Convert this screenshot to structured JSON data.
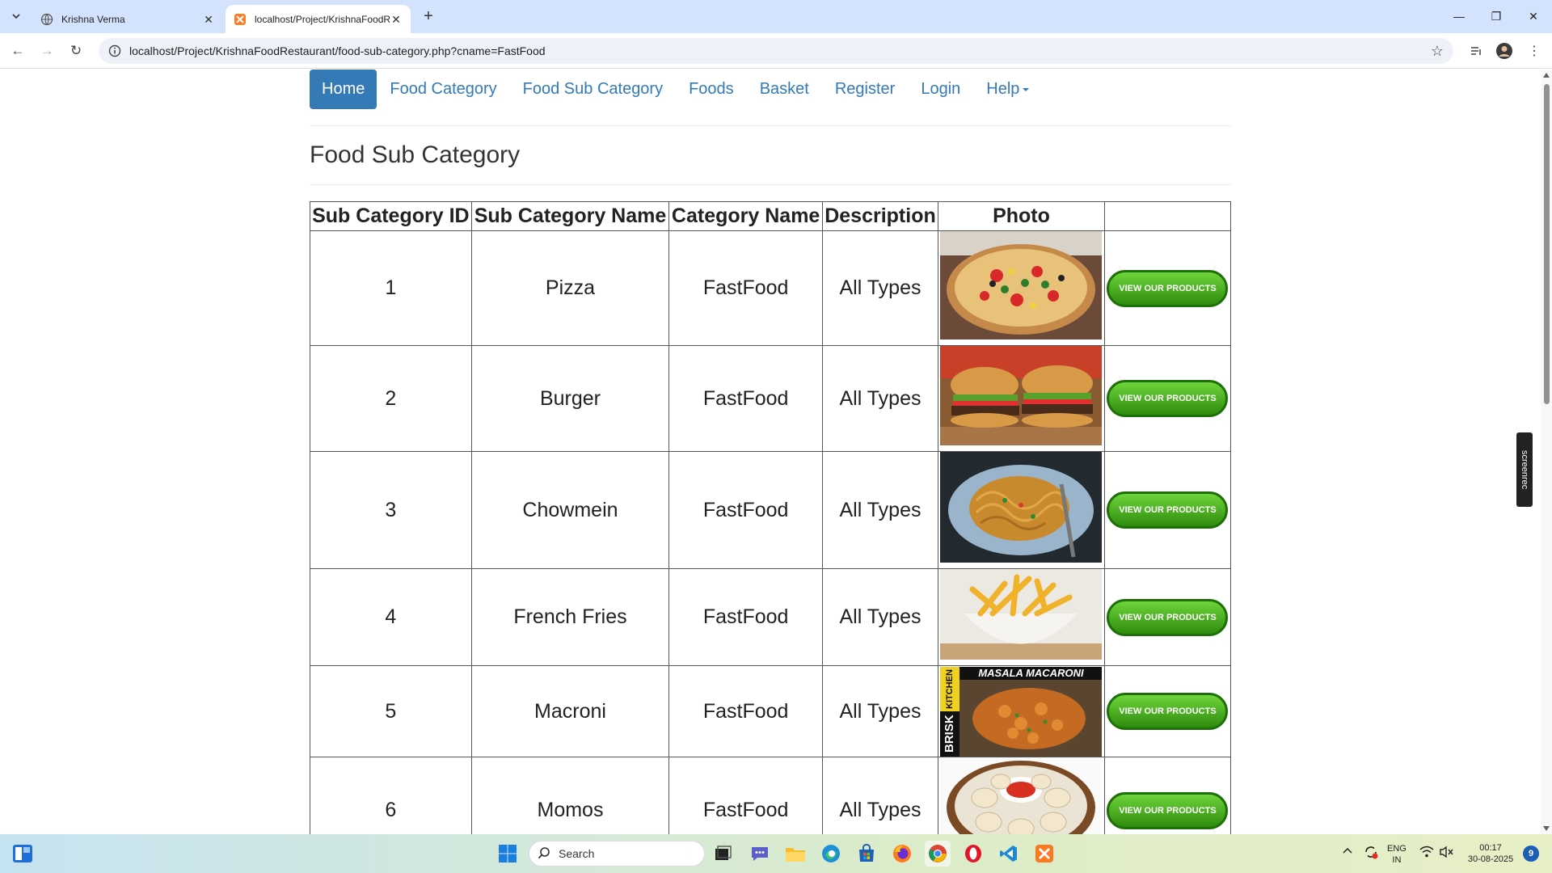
{
  "browser": {
    "tabs": [
      {
        "title": "Krishna Verma",
        "active": false
      },
      {
        "title": "localhost/Project/KrishnaFoodR",
        "active": true
      }
    ],
    "url": "localhost/Project/KrishnaFoodRestaurant/food-sub-category.php?cname=FastFood"
  },
  "nav": {
    "items": [
      {
        "label": "Home",
        "active": true
      },
      {
        "label": "Food Category"
      },
      {
        "label": "Food Sub Category"
      },
      {
        "label": "Foods"
      },
      {
        "label": "Basket"
      },
      {
        "label": "Register"
      },
      {
        "label": "Login"
      },
      {
        "label": "Help"
      }
    ]
  },
  "page": {
    "title": "Food Sub Category"
  },
  "table": {
    "headers": [
      "Sub Category ID",
      "Sub Category Name",
      "Category Name",
      "Description",
      "Photo",
      ""
    ],
    "button_label": "VIEW OUR PRODUCTS",
    "rows": [
      {
        "id": "1",
        "name": "Pizza",
        "category": "FastFood",
        "description": "All Types",
        "photo": "pizza"
      },
      {
        "id": "2",
        "name": "Burger",
        "category": "FastFood",
        "description": "All Types",
        "photo": "burger"
      },
      {
        "id": "3",
        "name": "Chowmein",
        "category": "FastFood",
        "description": "All Types",
        "photo": "chowmein"
      },
      {
        "id": "4",
        "name": "French Fries",
        "category": "FastFood",
        "description": "All Types",
        "photo": "fries"
      },
      {
        "id": "5",
        "name": "Macroni",
        "category": "FastFood",
        "description": "All Types",
        "photo": "macaroni",
        "photo_text_top": "MASALA MACARONI",
        "photo_text_side_1": "BRISK",
        "photo_text_side_2": "KITCHEN"
      },
      {
        "id": "6",
        "name": "Momos",
        "category": "FastFood",
        "description": "All Types",
        "photo": "momos"
      }
    ]
  },
  "overlay": {
    "screenrec": "screenrec"
  },
  "taskbar": {
    "search_placeholder": "Search",
    "lang_1": "ENG",
    "lang_2": "IN",
    "time": "00:17",
    "date": "30-08-2025",
    "notification_count": "9"
  },
  "colors": {
    "link": "#337ab7",
    "button_green": "#3aa516",
    "tab_strip": "#d3e3fd"
  }
}
